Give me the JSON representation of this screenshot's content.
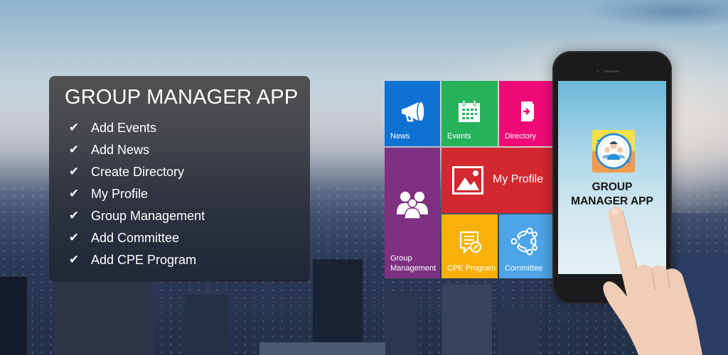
{
  "panel": {
    "title": "GROUP MANAGER APP",
    "features": [
      {
        "label": "Add Events"
      },
      {
        "label": "Add News"
      },
      {
        "label": "Create Directory"
      },
      {
        "label": "My Profile"
      },
      {
        "label": "Group Management"
      },
      {
        "label": "Add Committee"
      },
      {
        "label": "Add CPE Program"
      }
    ],
    "check_icon": "✔"
  },
  "tiles": {
    "news": {
      "label": "News",
      "icon": "megaphone-icon",
      "color": "#0f72d3"
    },
    "events": {
      "label": "Events",
      "icon": "calendar-icon",
      "color": "#25b25a"
    },
    "directory": {
      "label": "Directory",
      "icon": "directory-book-icon",
      "color": "#ef0a78"
    },
    "group": {
      "label_line1": "Group",
      "label_line2": "Management",
      "icon": "group-people-icon",
      "color": "#7f3181"
    },
    "profile": {
      "label": "My Profile",
      "icon": "image-picture-icon",
      "color": "#d3282f"
    },
    "cpe": {
      "label": "CPE Program",
      "icon": "certificate-edit-icon",
      "color": "#f8b10a"
    },
    "committee": {
      "label": "Committee",
      "icon": "committee-circle-icon",
      "color": "#4da4e6"
    }
  },
  "phone": {
    "screen_title_line1": "GROUP",
    "screen_title_line2": "MANAGER APP",
    "app_icon": "group-sync-app-icon"
  }
}
